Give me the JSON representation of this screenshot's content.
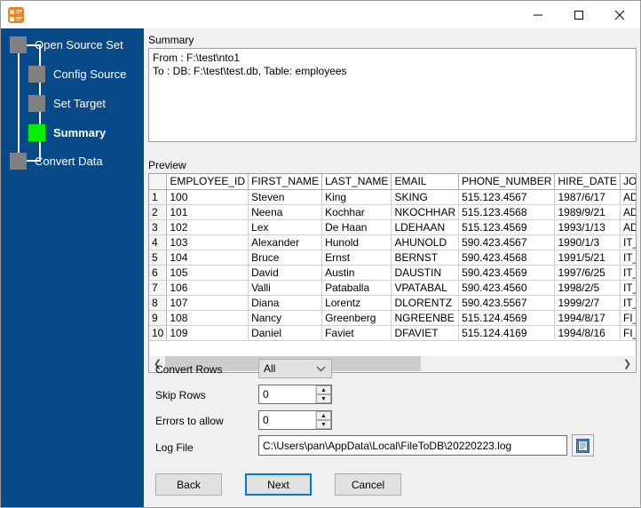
{
  "window": {
    "app_icon": "filetodb-app-icon",
    "title": "",
    "controls": {
      "minimize": "minimize-icon",
      "maximize": "maximize-icon",
      "close": "close-icon"
    }
  },
  "sidebar": {
    "background_color": "#084a87",
    "steps": [
      {
        "label": "Open Source Set",
        "state": "done"
      },
      {
        "label": "Config Source",
        "state": "done"
      },
      {
        "label": "Set Target",
        "state": "done"
      },
      {
        "label": "Summary",
        "state": "current"
      },
      {
        "label": "Convert Data",
        "state": "pending"
      }
    ],
    "current_color": "#00f000",
    "pending_color": "#808080"
  },
  "summary": {
    "group_title": "Summary",
    "text": "From : F:\\test\\nto1\nTo : DB: F:\\test\\test.db, Table: employees"
  },
  "preview": {
    "group_title": "Preview",
    "columns": [
      "",
      "EMPLOYEE_ID",
      "FIRST_NAME",
      "LAST_NAME",
      "EMAIL",
      "PHONE_NUMBER",
      "HIRE_DATE",
      "JOB_"
    ],
    "rows": [
      [
        "1",
        "100",
        "Steven",
        "King",
        "SKING",
        "515.123.4567",
        "1987/6/17",
        "AD_"
      ],
      [
        "2",
        "101",
        "Neena",
        "Kochhar",
        "NKOCHHAR",
        "515.123.4568",
        "1989/9/21",
        "AD_"
      ],
      [
        "3",
        "102",
        "Lex",
        "De Haan",
        "LDEHAAN",
        "515.123.4569",
        "1993/1/13",
        "AD_"
      ],
      [
        "4",
        "103",
        "Alexander",
        "Hunold",
        "AHUNOLD",
        "590.423.4567",
        "1990/1/3",
        "IT_P"
      ],
      [
        "5",
        "104",
        "Bruce",
        "Ernst",
        "BERNST",
        "590.423.4568",
        "1991/5/21",
        "IT_P"
      ],
      [
        "6",
        "105",
        "David",
        "Austin",
        "DAUSTIN",
        "590.423.4569",
        "1997/6/25",
        "IT_P"
      ],
      [
        "7",
        "106",
        "Valli",
        "Pataballa",
        "VPATABAL",
        "590.423.4560",
        "1998/2/5",
        "IT_P"
      ],
      [
        "8",
        "107",
        "Diana",
        "Lorentz",
        "DLORENTZ",
        "590.423.5567",
        "1999/2/7",
        "IT_P"
      ],
      [
        "9",
        "108",
        "Nancy",
        "Greenberg",
        "NGREENBE",
        "515.124.4569",
        "1994/8/17",
        "FI_M"
      ],
      [
        "10",
        "109",
        "Daniel",
        "Faviet",
        "DFAVIET",
        "515.124.4169",
        "1994/8/16",
        "FI_A"
      ]
    ],
    "scrollbar": {
      "left_arrow": "scroll-left-icon",
      "right_arrow": "scroll-right-icon"
    }
  },
  "options": {
    "convert_rows_label": "Convert Rows",
    "convert_rows_value": "All",
    "skip_rows_label": "Skip Rows",
    "skip_rows_value": "0",
    "errors_label": "Errors to allow",
    "errors_value": "0",
    "log_file_label": "Log File",
    "log_file_value": "C:\\Users\\pan\\AppData\\Local\\FileToDB\\20220223.log",
    "browse_icon": "document-browse-icon"
  },
  "buttons": {
    "back": "Back",
    "next": "Next",
    "cancel": "Cancel",
    "default_focus_color": "#0078d7"
  }
}
